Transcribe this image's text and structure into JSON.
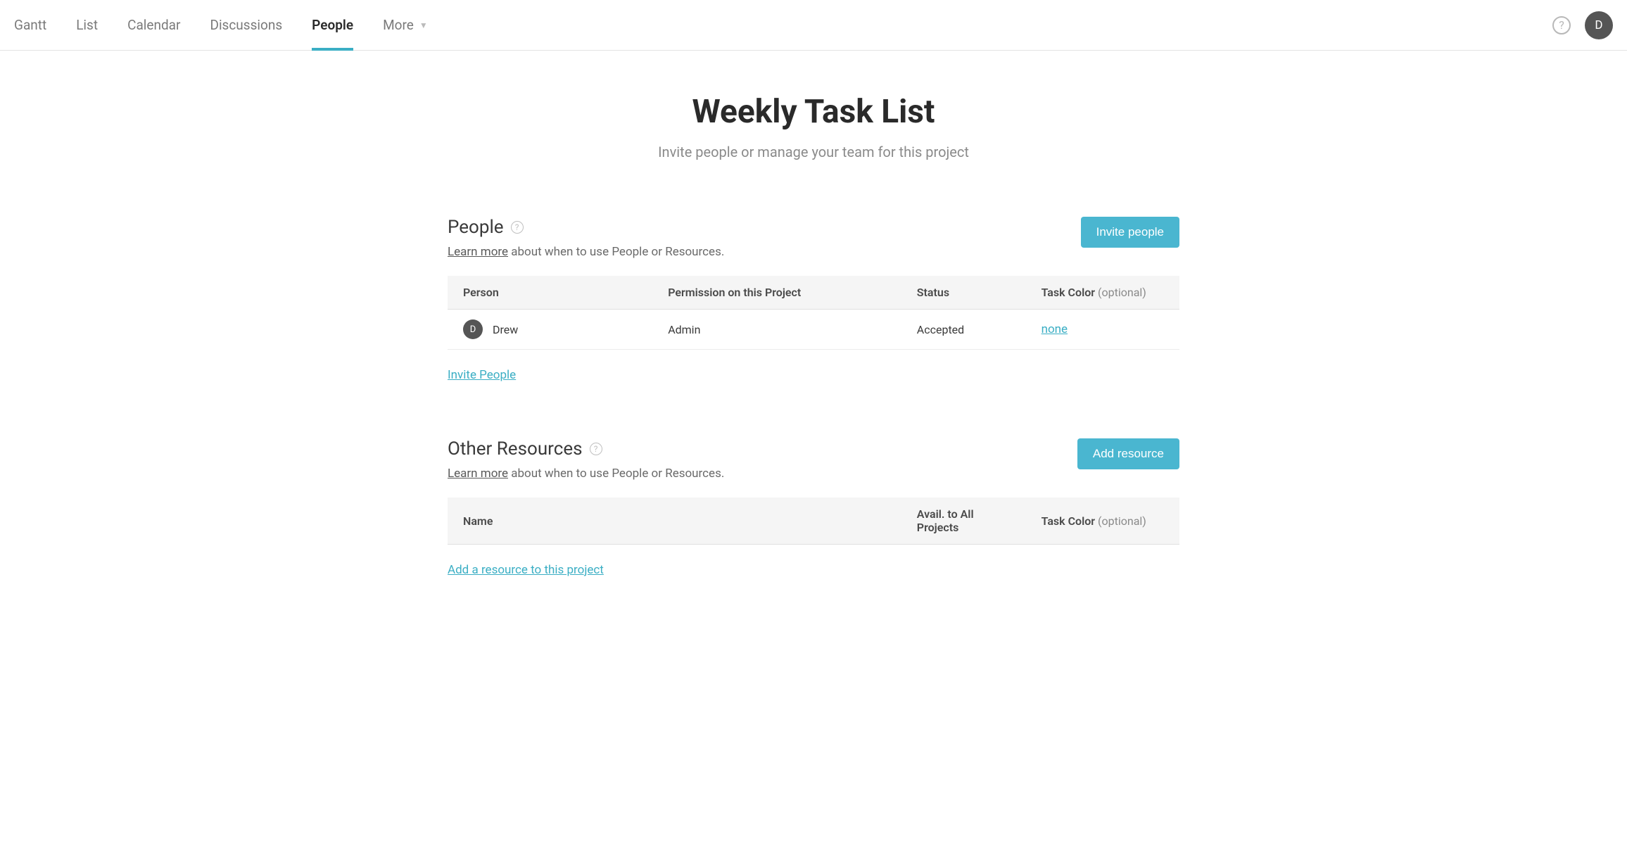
{
  "nav": {
    "tabs": [
      "Gantt",
      "List",
      "Calendar",
      "Discussions",
      "People"
    ],
    "more_label": "More",
    "active_index": 4
  },
  "user": {
    "avatar_initial": "D"
  },
  "page": {
    "title": "Weekly Task List",
    "subtitle": "Invite people or manage your team for this project"
  },
  "people_section": {
    "title": "People",
    "learn_more_label": "Learn more",
    "help_text": " about when to use People or Resources.",
    "invite_button": "Invite people",
    "columns": {
      "person": "Person",
      "permission": "Permission on this Project",
      "status": "Status",
      "task_color": "Task Color",
      "optional": " (optional)"
    },
    "rows": [
      {
        "initial": "D",
        "name": "Drew",
        "permission": "Admin",
        "status": "Accepted",
        "color": "none"
      }
    ],
    "invite_link": "Invite People"
  },
  "resources_section": {
    "title": "Other Resources",
    "learn_more_label": "Learn more",
    "help_text": " about when to use People or Resources.",
    "add_button": "Add resource",
    "columns": {
      "name": "Name",
      "avail": "Avail. to All Projects",
      "task_color": "Task Color",
      "optional": " (optional)"
    },
    "add_link": "Add a resource to this project"
  }
}
